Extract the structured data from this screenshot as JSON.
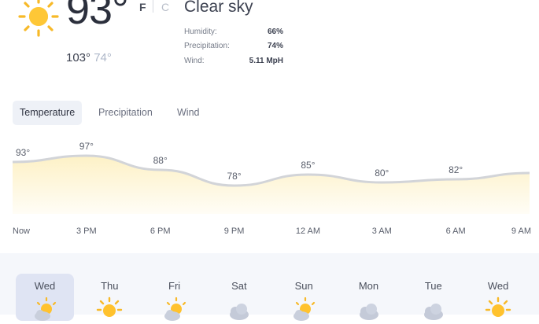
{
  "current": {
    "temperature": "93°",
    "unit_f": "F",
    "unit_c": "C",
    "condition": "Clear sky",
    "high": "103°",
    "low": "74°",
    "icon": "sun-icon",
    "stats": [
      {
        "label": "Humidity:",
        "value": "66%"
      },
      {
        "label": "Precipitation:",
        "value": "74%"
      },
      {
        "label": "Wind:",
        "value": "5.11 MpH"
      }
    ]
  },
  "tabs": [
    {
      "label": "Temperature",
      "active": true
    },
    {
      "label": "Precipitation",
      "active": false
    },
    {
      "label": "Wind",
      "active": false
    }
  ],
  "chart_data": {
    "type": "area",
    "x": [
      "Now",
      "3 PM",
      "6 PM",
      "9 PM",
      "12 AM",
      "3 AM",
      "6 AM",
      "9 AM"
    ],
    "values": [
      93,
      97,
      88,
      78,
      85,
      80,
      82,
      86
    ],
    "labels": [
      "93°",
      "97°",
      "88°",
      "78°",
      "85°",
      "80°",
      "82°",
      ""
    ],
    "line_color": "#d2d4d8",
    "fill_color": "#fdf4d2"
  },
  "forecast": [
    {
      "day": "Wed",
      "icon": "partly-cloudy-icon",
      "selected": true
    },
    {
      "day": "Thu",
      "icon": "sun-icon",
      "selected": false
    },
    {
      "day": "Fri",
      "icon": "partly-cloudy-icon",
      "selected": false
    },
    {
      "day": "Sat",
      "icon": "cloud-icon",
      "selected": false
    },
    {
      "day": "Sun",
      "icon": "partly-cloudy-icon",
      "selected": false
    },
    {
      "day": "Mon",
      "icon": "cloud-icon",
      "selected": false
    },
    {
      "day": "Tue",
      "icon": "cloud-icon",
      "selected": false
    },
    {
      "day": "Wed",
      "icon": "sun-icon",
      "selected": false
    }
  ]
}
